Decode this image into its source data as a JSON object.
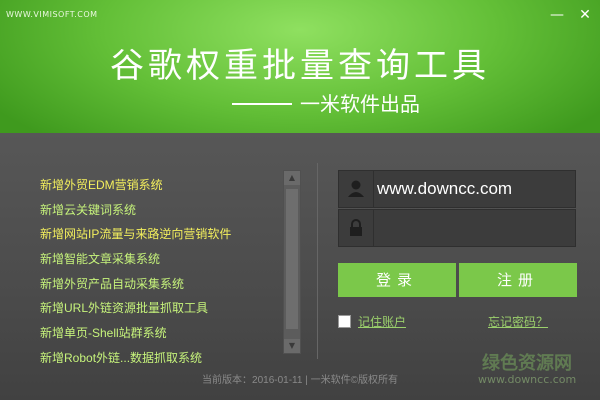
{
  "window": {
    "watermark": "WWW.VIMISOFT.COM",
    "title": "谷歌权重批量查询工具",
    "subtitle": "一米软件出品",
    "minimize_glyph": "—",
    "close_glyph": "✕"
  },
  "news": {
    "items": [
      {
        "label": "新增外贸EDM营销系统",
        "highlight": true
      },
      {
        "label": "新增云关键词系统",
        "highlight": false
      },
      {
        "label": "新增网站IP流量与来路逆向营销软件",
        "highlight": true
      },
      {
        "label": "新增智能文章采集系统",
        "highlight": false
      },
      {
        "label": "新增外贸产品自动采集系统",
        "highlight": false
      },
      {
        "label": "新增URL外链资源批量抓取工具",
        "highlight": false
      },
      {
        "label": "新增单页-Shell站群系统",
        "highlight": false
      },
      {
        "label": "新增Robot外链...数据抓取系统",
        "highlight": false
      }
    ]
  },
  "login": {
    "username_value": "www.downcc.com",
    "password_value": "",
    "user_icon": "user-icon",
    "lock_icon": "lock-icon",
    "login_label": "登录",
    "register_label": "注册",
    "remember_label": "记住账户",
    "forgot_label": "忘记密码？"
  },
  "footer": {
    "version_text": "当前版本：2016-01-11 | 一米软件©版权所有",
    "watermark_big": "绿色资源网",
    "watermark_small": "www.downcc.com"
  },
  "colors": {
    "accent": "#7bc84a",
    "news_text": "#c6f37b",
    "news_highlight": "#f3ef5d",
    "link": "#9bd06c"
  }
}
